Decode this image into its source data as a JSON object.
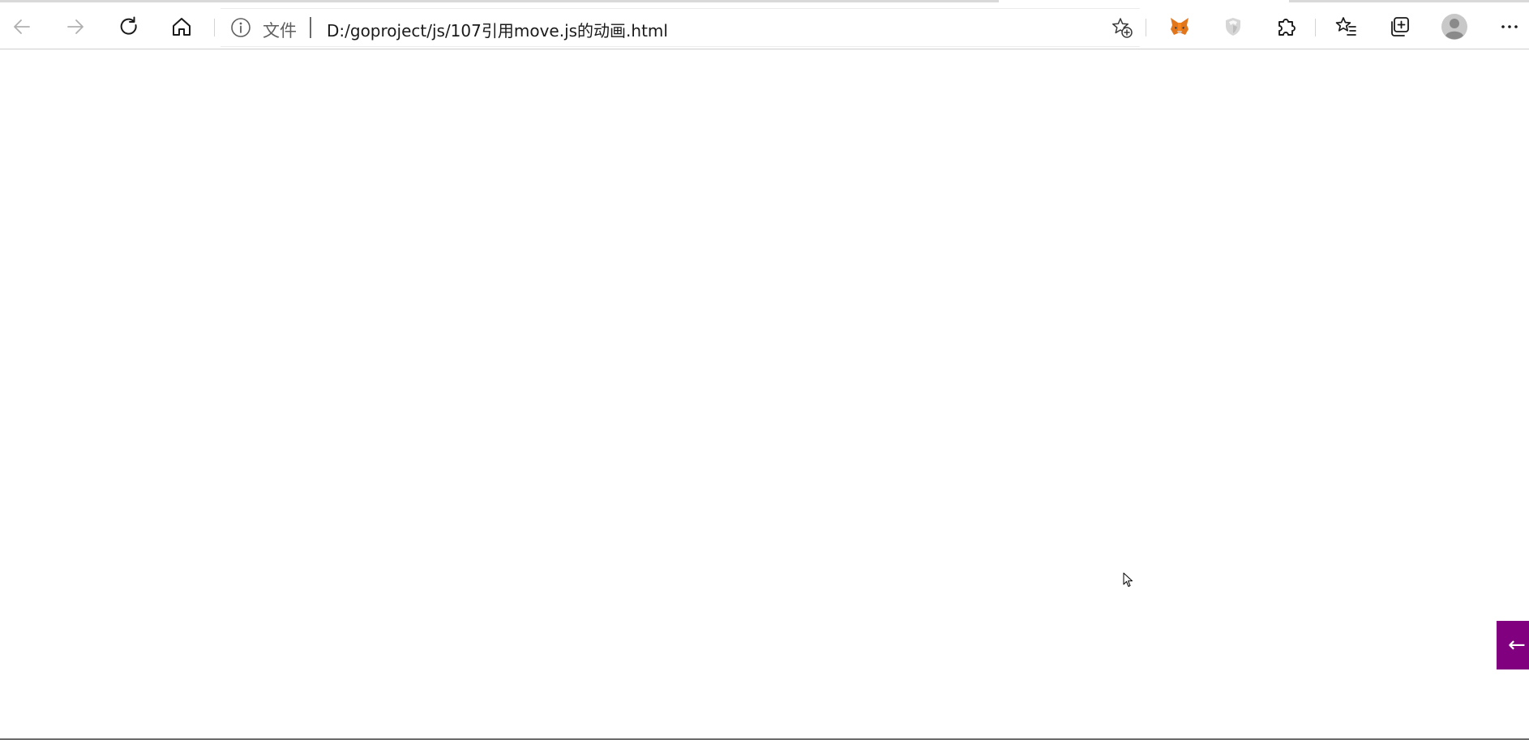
{
  "window": {
    "page_title": "107引用move.js的动画.html"
  },
  "toolbar": {
    "back": {
      "icon": "arrow-left-icon",
      "enabled": false
    },
    "forward": {
      "icon": "arrow-right-icon",
      "enabled": false
    },
    "refresh": {
      "icon": "refresh-icon"
    },
    "home": {
      "icon": "home-icon"
    },
    "extensions": [
      {
        "name": "metamask-extension",
        "icon": "fox-icon"
      },
      {
        "name": "shield-extension",
        "icon": "shield-icon"
      },
      {
        "name": "extensions-menu",
        "icon": "puzzle-icon"
      }
    ],
    "favorites": {
      "icon": "favorites-list-icon"
    },
    "collections": {
      "icon": "collections-icon"
    },
    "profile": {
      "icon": "avatar-icon"
    },
    "more": {
      "icon": "more-icon",
      "label": "···"
    }
  },
  "address_bar": {
    "info_icon": "info-icon",
    "scheme_label": "文件",
    "url": "D:/goproject/js/107引用move.js的动画.html",
    "favorite_add_icon": "star-add-icon"
  },
  "page": {
    "side_tab_label": "←",
    "side_tab_color": "#800080",
    "background": "#ffffff"
  },
  "colors": {
    "accent": "#800080",
    "toolbar_icon": "#1a1a1a",
    "disabled_icon": "#a8a8a8"
  }
}
